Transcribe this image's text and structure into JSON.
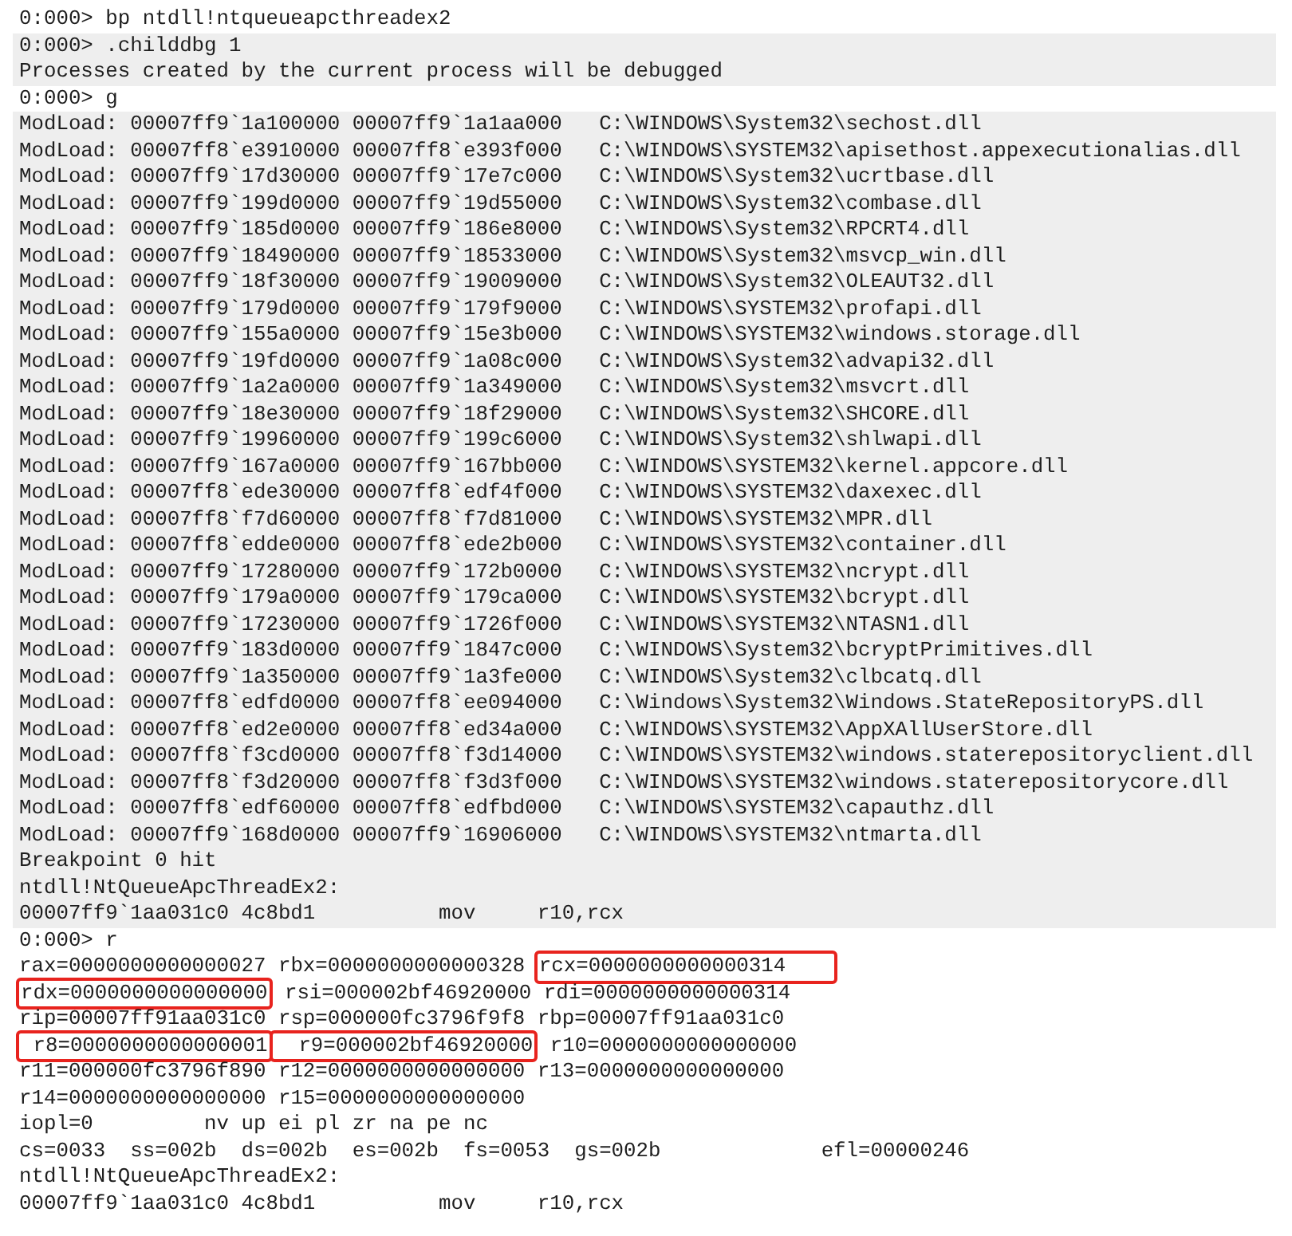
{
  "console": {
    "lines": [
      {
        "kind": "text",
        "shaded": false,
        "text": "0:000> bp ntdll!ntqueueapcthreadex2"
      },
      {
        "kind": "text",
        "shaded": true,
        "text": "0:000> .childdbg 1"
      },
      {
        "kind": "text",
        "shaded": true,
        "text": "Processes created by the current process will be debugged"
      },
      {
        "kind": "text",
        "shaded": false,
        "text": "0:000> g"
      },
      {
        "kind": "text",
        "shaded": true,
        "text": "ModLoad: 00007ff9`1a100000 00007ff9`1a1aa000   C:\\WINDOWS\\System32\\sechost.dll"
      },
      {
        "kind": "text",
        "shaded": true,
        "text": "ModLoad: 00007ff8`e3910000 00007ff8`e393f000   C:\\WINDOWS\\SYSTEM32\\apisethost.appexecutionalias.dll"
      },
      {
        "kind": "text",
        "shaded": true,
        "text": "ModLoad: 00007ff9`17d30000 00007ff9`17e7c000   C:\\WINDOWS\\System32\\ucrtbase.dll"
      },
      {
        "kind": "text",
        "shaded": true,
        "text": "ModLoad: 00007ff9`199d0000 00007ff9`19d55000   C:\\WINDOWS\\System32\\combase.dll"
      },
      {
        "kind": "text",
        "shaded": true,
        "text": "ModLoad: 00007ff9`185d0000 00007ff9`186e8000   C:\\WINDOWS\\System32\\RPCRT4.dll"
      },
      {
        "kind": "text",
        "shaded": true,
        "text": "ModLoad: 00007ff9`18490000 00007ff9`18533000   C:\\WINDOWS\\System32\\msvcp_win.dll"
      },
      {
        "kind": "text",
        "shaded": true,
        "text": "ModLoad: 00007ff9`18f30000 00007ff9`19009000   C:\\WINDOWS\\System32\\OLEAUT32.dll"
      },
      {
        "kind": "text",
        "shaded": true,
        "text": "ModLoad: 00007ff9`179d0000 00007ff9`179f9000   C:\\WINDOWS\\SYSTEM32\\profapi.dll"
      },
      {
        "kind": "text",
        "shaded": true,
        "text": "ModLoad: 00007ff9`155a0000 00007ff9`15e3b000   C:\\WINDOWS\\SYSTEM32\\windows.storage.dll"
      },
      {
        "kind": "text",
        "shaded": true,
        "text": "ModLoad: 00007ff9`19fd0000 00007ff9`1a08c000   C:\\WINDOWS\\System32\\advapi32.dll"
      },
      {
        "kind": "text",
        "shaded": true,
        "text": "ModLoad: 00007ff9`1a2a0000 00007ff9`1a349000   C:\\WINDOWS\\System32\\msvcrt.dll"
      },
      {
        "kind": "text",
        "shaded": true,
        "text": "ModLoad: 00007ff9`18e30000 00007ff9`18f29000   C:\\WINDOWS\\System32\\SHCORE.dll"
      },
      {
        "kind": "text",
        "shaded": true,
        "text": "ModLoad: 00007ff9`19960000 00007ff9`199c6000   C:\\WINDOWS\\System32\\shlwapi.dll"
      },
      {
        "kind": "text",
        "shaded": true,
        "text": "ModLoad: 00007ff9`167a0000 00007ff9`167bb000   C:\\WINDOWS\\SYSTEM32\\kernel.appcore.dll"
      },
      {
        "kind": "text",
        "shaded": true,
        "text": "ModLoad: 00007ff8`ede30000 00007ff8`edf4f000   C:\\WINDOWS\\SYSTEM32\\daxexec.dll"
      },
      {
        "kind": "text",
        "shaded": true,
        "text": "ModLoad: 00007ff8`f7d60000 00007ff8`f7d81000   C:\\WINDOWS\\SYSTEM32\\MPR.dll"
      },
      {
        "kind": "text",
        "shaded": true,
        "text": "ModLoad: 00007ff8`edde0000 00007ff8`ede2b000   C:\\WINDOWS\\SYSTEM32\\container.dll"
      },
      {
        "kind": "text",
        "shaded": true,
        "text": "ModLoad: 00007ff9`17280000 00007ff9`172b0000   C:\\WINDOWS\\SYSTEM32\\ncrypt.dll"
      },
      {
        "kind": "text",
        "shaded": true,
        "text": "ModLoad: 00007ff9`179a0000 00007ff9`179ca000   C:\\WINDOWS\\SYSTEM32\\bcrypt.dll"
      },
      {
        "kind": "text",
        "shaded": true,
        "text": "ModLoad: 00007ff9`17230000 00007ff9`1726f000   C:\\WINDOWS\\SYSTEM32\\NTASN1.dll"
      },
      {
        "kind": "text",
        "shaded": true,
        "text": "ModLoad: 00007ff9`183d0000 00007ff9`1847c000   C:\\WINDOWS\\System32\\bcryptPrimitives.dll"
      },
      {
        "kind": "text",
        "shaded": true,
        "text": "ModLoad: 00007ff9`1a350000 00007ff9`1a3fe000   C:\\WINDOWS\\System32\\clbcatq.dll"
      },
      {
        "kind": "text",
        "shaded": true,
        "text": "ModLoad: 00007ff8`edfd0000 00007ff8`ee094000   C:\\Windows\\System32\\Windows.StateRepositoryPS.dll"
      },
      {
        "kind": "text",
        "shaded": true,
        "text": "ModLoad: 00007ff8`ed2e0000 00007ff8`ed34a000   C:\\WINDOWS\\SYSTEM32\\AppXAllUserStore.dll"
      },
      {
        "kind": "text",
        "shaded": true,
        "text": "ModLoad: 00007ff8`f3cd0000 00007ff8`f3d14000   C:\\WINDOWS\\SYSTEM32\\windows.staterepositoryclient.dll"
      },
      {
        "kind": "text",
        "shaded": true,
        "text": "ModLoad: 00007ff8`f3d20000 00007ff8`f3d3f000   C:\\WINDOWS\\SYSTEM32\\windows.staterepositorycore.dll"
      },
      {
        "kind": "text",
        "shaded": true,
        "text": "ModLoad: 00007ff8`edf60000 00007ff8`edfbd000   C:\\WINDOWS\\SYSTEM32\\capauthz.dll"
      },
      {
        "kind": "text",
        "shaded": true,
        "text": "ModLoad: 00007ff9`168d0000 00007ff9`16906000   C:\\WINDOWS\\SYSTEM32\\ntmarta.dll"
      },
      {
        "kind": "text",
        "shaded": true,
        "text": "Breakpoint 0 hit"
      },
      {
        "kind": "text",
        "shaded": true,
        "text": "ntdll!NtQueueApcThreadEx2:"
      },
      {
        "kind": "text",
        "shaded": true,
        "text": "00007ff9`1aa031c0 4c8bd1          mov     r10,rcx"
      },
      {
        "kind": "text",
        "shaded": false,
        "text": "0:000> r"
      },
      {
        "kind": "registers",
        "shaded": false,
        "segments": [
          {
            "text": "rax=0000000000000027 ",
            "boxed": false
          },
          {
            "text": "rbx=0000000000000328 ",
            "boxed": false
          },
          {
            "text": "rcx=0000000000000314",
            "boxed": true
          }
        ]
      },
      {
        "kind": "registers",
        "shaded": false,
        "segments": [
          {
            "text": "rdx=0000000000000000",
            "boxed": true
          },
          {
            "text": " rsi=000002bf46920000 ",
            "boxed": false
          },
          {
            "text": "rdi=0000000000000314",
            "boxed": false
          }
        ]
      },
      {
        "kind": "registers",
        "shaded": false,
        "segments": [
          {
            "text": "rip=00007ff91aa031c0 ",
            "boxed": false
          },
          {
            "text": "rsp=000000fc3796f9f8 ",
            "boxed": false
          },
          {
            "text": "rbp=00007ff91aa031c0",
            "boxed": false
          }
        ]
      },
      {
        "kind": "registers",
        "shaded": false,
        "segments": [
          {
            "text": " r8=0000000000000001",
            "boxed": true
          },
          {
            "text": "  r9=000002bf46920000",
            "boxed": true
          },
          {
            "text": " r10=0000000000000000",
            "boxed": false
          }
        ]
      },
      {
        "kind": "registers",
        "shaded": false,
        "segments": [
          {
            "text": "r11=000000fc3796f890 ",
            "boxed": false
          },
          {
            "text": "r12=0000000000000000 ",
            "boxed": false
          },
          {
            "text": "r13=0000000000000000",
            "boxed": false
          }
        ]
      },
      {
        "kind": "registers",
        "shaded": false,
        "segments": [
          {
            "text": "r14=0000000000000000 ",
            "boxed": false
          },
          {
            "text": "r15=0000000000000000",
            "boxed": false
          }
        ]
      },
      {
        "kind": "text",
        "shaded": false,
        "text": "iopl=0         nv up ei pl zr na pe nc"
      },
      {
        "kind": "text",
        "shaded": false,
        "text": "cs=0033  ss=002b  ds=002b  es=002b  fs=0053  gs=002b             efl=00000246"
      },
      {
        "kind": "text",
        "shaded": false,
        "text": "ntdll!NtQueueApcThreadEx2:"
      },
      {
        "kind": "text",
        "shaded": false,
        "text": "00007ff9`1aa031c0 4c8bd1          mov     r10,rcx"
      }
    ]
  }
}
